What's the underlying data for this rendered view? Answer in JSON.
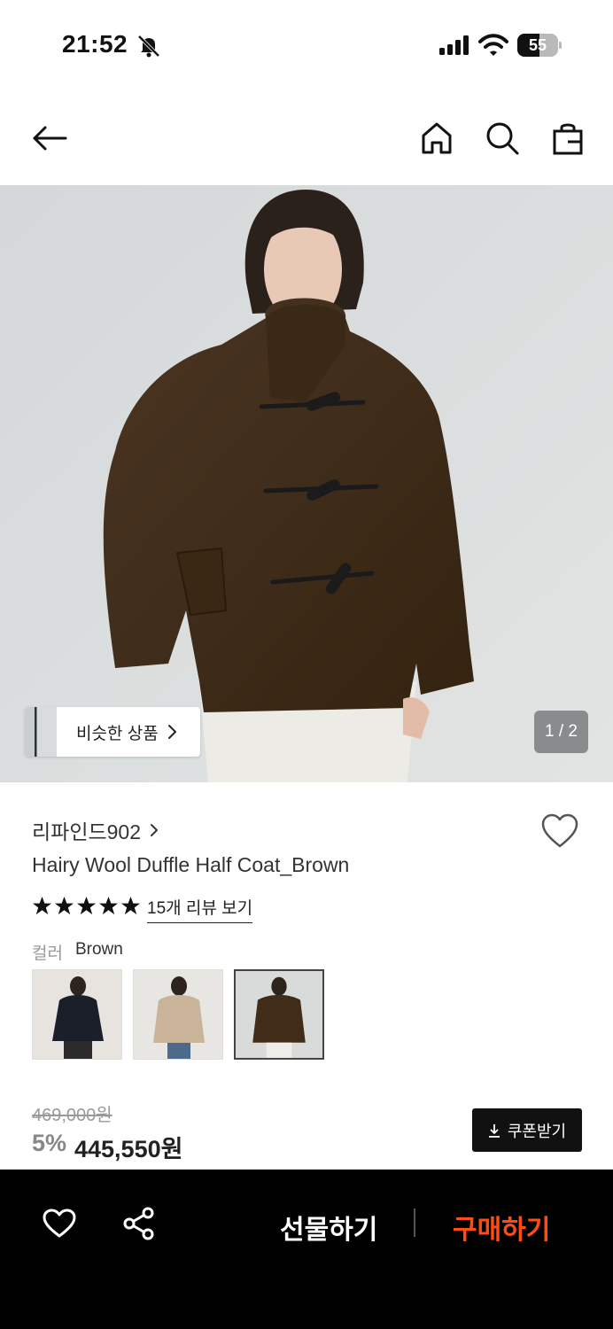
{
  "status_bar": {
    "time": "21:52",
    "battery": "55",
    "battery_level": 0.55,
    "icons": [
      "bell-off-icon",
      "signal-icon",
      "wifi-icon",
      "battery-icon"
    ]
  },
  "nav": {
    "icons": [
      "back-arrow-icon",
      "home-icon",
      "search-icon",
      "shopping-bag-icon"
    ]
  },
  "hero": {
    "similar_label": "비슷한 상품",
    "page_indicator": "1 / 2"
  },
  "product": {
    "brand": "리파인드902",
    "title": "Hairy Wool Duffle Half Coat_Brown",
    "rating": 5,
    "review_link": "15개 리뷰 보기",
    "color_label": "컬러",
    "color_value": "Brown",
    "original_price": "469,000원",
    "discount": "5%",
    "price": "445,550원",
    "coupon_button": "쿠폰받기"
  },
  "bottom_bar": {
    "gift_label": "선물하기",
    "buy_label": "구매하기",
    "buy_color": "#ff4d12"
  }
}
